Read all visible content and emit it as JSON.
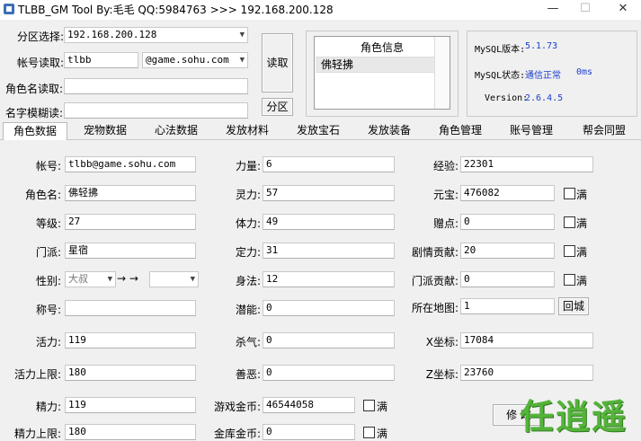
{
  "window": {
    "title": "TLBB_GM Tool By:毛毛 QQ:5984763 >>> 192.168.200.128",
    "min_icon": "minimize-icon",
    "max_icon": "maximize-icon",
    "close_icon": "close-icon",
    "min_glyph": "—",
    "max_glyph": "☐",
    "close_glyph": "✕"
  },
  "top": {
    "zone_label": "分区选择:",
    "zone_value": "192.168.200.128",
    "account_label": "帐号读取:",
    "account_value": "tlbb",
    "domain_value": "@game.sohu.com",
    "rolename_label": "角色名读取:",
    "rolename_value": "",
    "fuzzy_label": "名字模糊读:",
    "fuzzy_value": "",
    "read_button": "读取",
    "zone_button": "分区"
  },
  "role_info": {
    "header": "角色信息",
    "items": [
      "佛轻拂"
    ]
  },
  "mysql": {
    "version_label": "MySQL版本:",
    "version_value": "5.1.73",
    "status_label": "MySQL状态:",
    "status_value": "通信正常",
    "latency": "0ms",
    "app_version_label": "Version:",
    "app_version_value": "2.6.4.5",
    "value_color": "#1e40cc"
  },
  "tabs": [
    "角色数据",
    "宠物数据",
    "心法数据",
    "发放材料",
    "发放宝石",
    "发放装备",
    "角色管理",
    "账号管理",
    "帮会同盟"
  ],
  "active_tab": 0,
  "col1": {
    "account_label": "帐号:",
    "account_value": "tlbb@game.sohu.com",
    "name_label": "角色名:",
    "name_value": "佛轻拂",
    "level_label": "等级:",
    "level_value": "27",
    "school_label": "门派:",
    "school_value": "星宿",
    "gender_label": "性别:",
    "gender_value": "大叔",
    "gender_to": "→ →",
    "gender_target": "",
    "title_label": "称号:",
    "title_value": "",
    "vitality_label": "活力:",
    "vitality_value": "119",
    "vitality_max_label": "活力上限:",
    "vitality_max_value": "180",
    "energy_label": "精力:",
    "energy_value": "119",
    "energy_max_label": "精力上限:",
    "energy_max_value": "180"
  },
  "col2": {
    "str_label": "力量:",
    "str_value": "6",
    "spi_label": "灵力:",
    "spi_value": "57",
    "con_label": "体力:",
    "con_value": "49",
    "def_label": "定力:",
    "def_value": "31",
    "agi_label": "身法:",
    "agi_value": "12",
    "pot_label": "潜能:",
    "pot_value": "0",
    "kill_label": "杀气:",
    "kill_value": "0",
    "moral_label": "善恶:",
    "moral_value": "0",
    "gold_label": "游戏金币:",
    "gold_value": "46544058",
    "gold_full": "满",
    "bind_gold_label": "金库金币:",
    "bind_gold_value": "0",
    "bind_gold_full": "满"
  },
  "col3": {
    "exp_label": "经验:",
    "exp_value": "22301",
    "yuanbao_label": "元宝:",
    "yuanbao_value": "476082",
    "yuanbao_full": "满",
    "gift_label": "赠点:",
    "gift_value": "0",
    "gift_full": "满",
    "story_label": "剧情贡献:",
    "story_value": "20",
    "story_full": "满",
    "school_contrib_label": "门派贡献:",
    "school_contrib_value": "0",
    "school_contrib_full": "满",
    "map_label": "所在地图:",
    "map_value": "1",
    "return_button": "回城",
    "x_label": "X坐标:",
    "x_value": "17084",
    "z_label": "Z坐标:",
    "z_value": "23760",
    "modify_button": "修 改"
  },
  "watermark": "任逍遥"
}
